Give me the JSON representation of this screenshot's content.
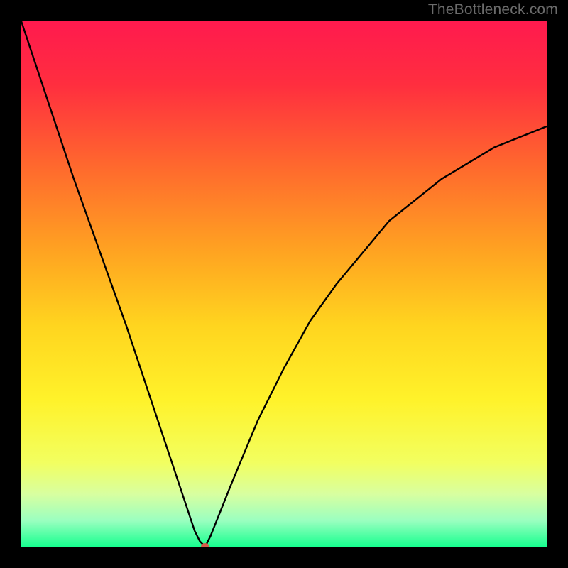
{
  "watermark": "TheBottleneck.com",
  "chart_data": {
    "type": "line",
    "title": "",
    "xlabel": "",
    "ylabel": "",
    "xlim": [
      0,
      100
    ],
    "ylim": [
      0,
      100
    ],
    "axes_visible": false,
    "background_gradient": {
      "stops": [
        {
          "pos": 0.0,
          "color": "#ff1a4e"
        },
        {
          "pos": 0.12,
          "color": "#ff2e3f"
        },
        {
          "pos": 0.28,
          "color": "#ff6a2d"
        },
        {
          "pos": 0.44,
          "color": "#ffa421"
        },
        {
          "pos": 0.58,
          "color": "#ffd51f"
        },
        {
          "pos": 0.72,
          "color": "#fff22a"
        },
        {
          "pos": 0.84,
          "color": "#f2ff60"
        },
        {
          "pos": 0.9,
          "color": "#d8ffa0"
        },
        {
          "pos": 0.95,
          "color": "#9bffc0"
        },
        {
          "pos": 1.0,
          "color": "#17ff8f"
        }
      ]
    },
    "series": [
      {
        "name": "bottleneck-curve",
        "x": [
          0,
          5,
          10,
          15,
          20,
          25,
          28,
          30,
          32,
          33,
          34,
          35,
          36,
          40,
          45,
          50,
          55,
          60,
          65,
          70,
          75,
          80,
          85,
          90,
          95,
          100
        ],
        "values": [
          100,
          85,
          70,
          56,
          42,
          27,
          18,
          12,
          6,
          3,
          1,
          0,
          2,
          12,
          24,
          34,
          43,
          50,
          56,
          62,
          66,
          70,
          73,
          76,
          78,
          80
        ]
      }
    ],
    "marker": {
      "name": "minimum-point",
      "x": 35,
      "y": 0,
      "color": "#d75a4a",
      "rx": 6,
      "ry": 5
    }
  }
}
